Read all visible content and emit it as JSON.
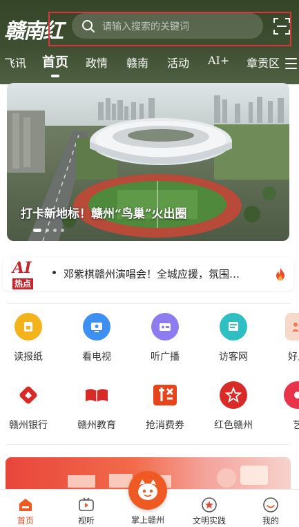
{
  "header": {
    "logo_text": "赣南红",
    "search_placeholder": "请输入搜索的关键词",
    "scan_icon": "scan-icon"
  },
  "nav_tabs": [
    {
      "label": "飞讯",
      "active": false
    },
    {
      "label": "首页",
      "active": true
    },
    {
      "label": "政情",
      "active": false
    },
    {
      "label": "赣南",
      "active": false
    },
    {
      "label": "活动",
      "active": false
    },
    {
      "label": "AI+",
      "active": false
    },
    {
      "label": "章贡区",
      "active": false
    }
  ],
  "banner": {
    "title": "打卡新地标！赣州“鸟巢”火出圈"
  },
  "ai_hot": {
    "logo_ai": "AI",
    "logo_hot": "热点",
    "headline": "邓紫棋赣州演唱会！全城应援，氛围…"
  },
  "service_grid": {
    "row1": [
      {
        "label": "读报纸",
        "icon": "newspaper-icon",
        "color": "#f5b31b"
      },
      {
        "label": "看电视",
        "icon": "tv-icon",
        "color": "#3d8ff2"
      },
      {
        "label": "听广播",
        "icon": "radio-icon",
        "color": "#8c7cf0"
      },
      {
        "label": "访客网",
        "icon": "web-icon",
        "color": "#2dbfc1"
      },
      {
        "label": "好人",
        "icon": "people-icon",
        "color": "#f07a58"
      }
    ],
    "row2": [
      {
        "label": "赣州银行",
        "icon": "bank-icon",
        "color": "#d82a26"
      },
      {
        "label": "赣州教育",
        "icon": "book-icon",
        "color": "#d82a26"
      },
      {
        "label": "抢消费券",
        "icon": "coupon-icon",
        "color": "#e8441c"
      },
      {
        "label": "红色赣州",
        "icon": "star-icon",
        "color": "#d82a26"
      },
      {
        "label": "艺",
        "icon": "art-icon",
        "color": "#e8344a"
      }
    ]
  },
  "tabbar": {
    "items": [
      {
        "label": "首页",
        "icon": "home-icon",
        "active": true
      },
      {
        "label": "视听",
        "icon": "video-icon",
        "active": false
      },
      {
        "label": "掌上赣州",
        "icon": "mascot-icon",
        "active": false
      },
      {
        "label": "文明实践",
        "icon": "badge-icon",
        "active": false
      },
      {
        "label": "我的",
        "icon": "profile-icon",
        "active": false
      }
    ]
  },
  "colors": {
    "header_bg": "#3e4f31",
    "accent": "#e3461f",
    "highlight": "#d9363e"
  }
}
